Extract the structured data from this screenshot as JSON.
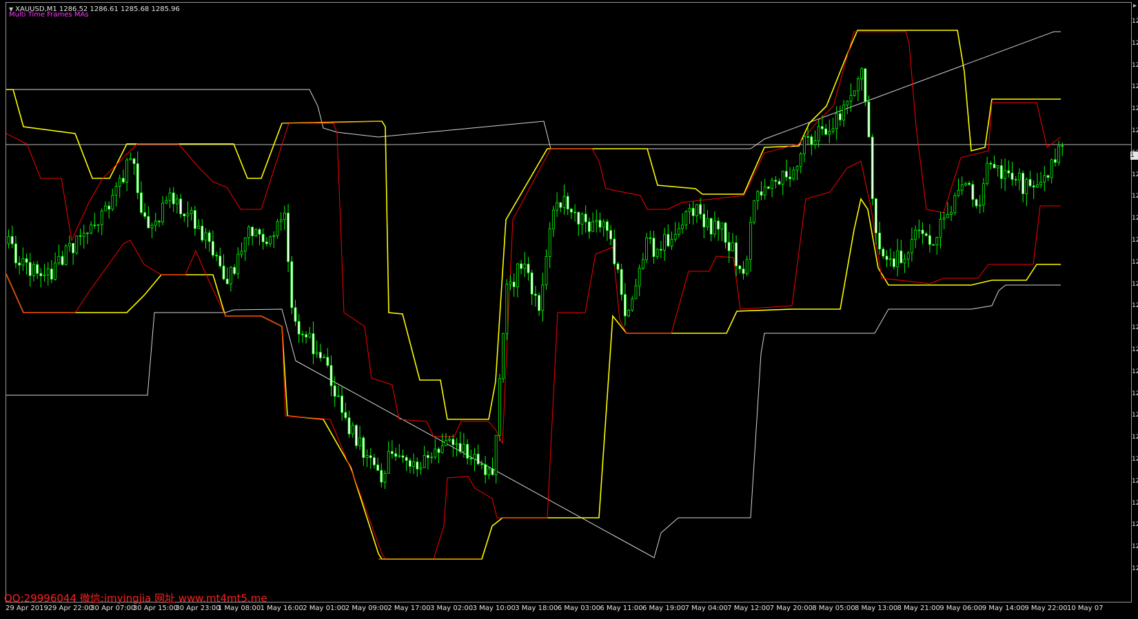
{
  "header": {
    "symbol_line": "XAUUSD,M1  1286.52 1286.61 1285.68 1285.96",
    "indicator_label": "Multi Time Frames MAs"
  },
  "watermark": "QQ:29996044 微信:imyingjia 网址 www.mt4mt5.me",
  "current_price": "1",
  "price_axis_labels": [
    "12",
    "12",
    "12",
    "12",
    "12",
    "12",
    "12",
    "12",
    "12",
    "12",
    "12",
    "12",
    "12",
    "12",
    "12",
    "12",
    "12",
    "12",
    "12",
    "12",
    "12",
    "12",
    "12",
    "12",
    "12",
    "12"
  ],
  "time_axis_labels": [
    "29 Apr 2019",
    "29 Apr 22:00",
    "30 Apr 07:00",
    "30 Apr 15:00",
    "30 Apr 23:00",
    "1 May 08:00",
    "1 May 16:00",
    "2 May 01:00",
    "2 May 09:00",
    "2 May 17:00",
    "3 May 02:00",
    "3 May 10:00",
    "3 May 18:00",
    "6 May 03:00",
    "6 May 11:00",
    "6 May 19:00",
    "7 May 04:00",
    "7 May 12:00",
    "7 May 20:00",
    "8 May 05:00",
    "8 May 13:00",
    "8 May 21:00",
    "9 May 06:00",
    "9 May 14:00",
    "9 May 22:00",
    "10 May 07"
  ],
  "colors": {
    "background": "#000000",
    "bull_candle": "#00ff00",
    "bear_candle_body": "#ffffff",
    "ma_white": "#d8d8d8",
    "ma_yellow": "#ffff00",
    "ma_red": "#ff0000",
    "ma_orange": "#ff8c00",
    "watermark": "#ff2020",
    "indicator_label": "#ff38ff"
  },
  "icons": {
    "symbol_triangle": "triangle-down-icon",
    "corner": "scroll-arrow-icon"
  },
  "chart_data": {
    "type": "line",
    "series": [
      {
        "values": [
          1289.0,
          1289.0,
          1289.0,
          1289.0,
          1289.0,
          1289.0,
          1289.0,
          1289.0,
          1289.0,
          1289.0,
          1289.0,
          1289.0,
          1289.0,
          1289.0,
          1289.0,
          1288.2,
          1288.0,
          1288.0,
          1288.0,
          1288.0,
          1287.9,
          1287.9,
          1287.9,
          1287.9,
          1287.9,
          1287.9,
          1287.9,
          1287.9,
          1287.9,
          1287.9,
          1287.9,
          1287.9,
          1287.9,
          1287.9,
          1287.9,
          1287.9,
          1287.9,
          1287.9,
          1287.6,
          1287.6,
          1287.6,
          1287.6,
          1287.6,
          1287.6,
          1287.6,
          1287.6,
          1287.6,
          1287.6,
          1287.6,
          1287.6,
          1287.6,
          1287.6,
          1287.6,
          1287.6,
          1287.6,
          1287.6,
          1287.6,
          1287.6,
          1287.6,
          1287.6,
          1287.6,
          1287.6,
          1287.6,
          1287.6,
          1287.6,
          1287.6,
          1287.6,
          1287.6,
          1287.6,
          1287.6,
          1287.6,
          1287.6,
          1287.6,
          1287.6,
          1287.6,
          1287.6,
          1287.6,
          1287.6,
          1291.2,
          1291.2,
          1291.2,
          1291.2,
          1291.2,
          1291.2,
          1291.2,
          1291.2,
          1291.2,
          1291.2,
          1291.2,
          1291.2,
          1291.2,
          1291.2,
          1291.2,
          1291.2,
          1291.2,
          1291.2,
          1291.2,
          1291.2,
          1291.2,
          1291.2,
          1291.2,
          1291.2,
          1291.2,
          1291.2,
          1291.2,
          1291.2,
          1291.2,
          1291.2,
          1291.2,
          1291.2,
          1291.2,
          1291.2,
          1291.2,
          1291.2,
          1291.2,
          1291.2,
          1291.2,
          1291.2,
          1291.2,
          1291.2,
          1291.2,
          1291.2,
          1291.2,
          1291.2,
          1291.2,
          1291.2,
          1291.2,
          1291.2,
          1291.2,
          1291.2,
          1291.2,
          1291.2,
          1291.2,
          1291.2,
          1291.2,
          1291.2,
          1291.2,
          1291.2,
          1291.2,
          1291.2,
          1291.2,
          1291.2,
          1291.2,
          1291.2,
          1291.2,
          1291.2,
          1291.2,
          1291.2,
          1291.2,
          1291.2,
          1291.2,
          1291.2,
          1291.2,
          1291.2,
          1291.2,
          1291.2,
          1291.2,
          1291.2,
          1291.2,
          1291.2,
          1291.2,
          1291.2,
          1291.2,
          1291.2,
          1291.2,
          1291.2,
          1291.2,
          1291.2,
          1291.2,
          1291.2,
          1291.2,
          1291.2,
          1291.2,
          1291.2,
          1291.2,
          1291.2,
          1291.2,
          1291.2,
          1291.2,
          1291.2,
          1291.2,
          1291.2,
          1291.2,
          1291.2,
          1291.2,
          1291.2,
          1291.2,
          1291.2,
          1291.2,
          1291.2,
          1291.2,
          1291.2,
          1291.2,
          1291.2,
          1291.2,
          1291.2,
          1291.2,
          1291.2,
          1291.2,
          1291.2,
          1291.2,
          1291.2,
          1291.2,
          1291.2,
          1291.2,
          1291.2,
          1291.2,
          1291.2,
          1291.2,
          1291.2,
          1291.2,
          1291.2,
          1291.2,
          1291.2,
          1291.2,
          1291.2,
          1291.2,
          1291.2,
          1291.2,
          1291.2,
          1291.2,
          1291.2,
          1291.2,
          1291.2,
          1291.2,
          1291.2,
          1291.2,
          1291.2,
          1291.2,
          1291.2,
          1291.2,
          1291.2,
          1291.2,
          1291.2,
          1291.2,
          1291.2,
          1291.2,
          1291.2,
          1291.2,
          1291.2,
          1291.2,
          1291.2,
          1291.2,
          1291.2,
          1291.2,
          1291.2,
          1291.2,
          1291.2,
          1291.2,
          1291.2,
          1291.2,
          1291.2,
          1291.2,
          1291.2,
          1291.2,
          1291.2,
          1291.2,
          1291.2,
          1291.2,
          1291.2,
          1291.2,
          1291.2,
          1291.2,
          1291.2,
          1291.2,
          1291.2,
          1291.2,
          1291.2,
          1291.2
        ]
      },
      {
        "values": [
          1284.7,
          1284.7,
          1284.7,
          1284.7,
          1284.7,
          1284.7,
          1284.7,
          1284.7,
          1284.7,
          1284.7,
          1284.7,
          1284.7,
          1284.7,
          1284.7,
          1284.7,
          1284.7,
          1284.7,
          1284.7,
          1284.7,
          1284.7,
          1284.7,
          1284.7,
          1284.7,
          1284.7,
          1284.7,
          1284.7,
          1284.7,
          1284.7,
          1284.7,
          1284.7,
          1284.7,
          1284.7,
          1284.7,
          1284.7,
          1284.7,
          1284.7,
          1284.7,
          1284.7,
          1284.7,
          1284.7,
          1284.7,
          1284.7,
          1284.7,
          1284.7,
          1284.7,
          1284.7,
          1284.7,
          1284.7,
          1284.7,
          1284.7,
          1284.7,
          1284.7,
          1284.7,
          1284.7,
          1284.7,
          1284.7,
          1284.7,
          1284.7,
          1284.7,
          1284.7,
          1284.7,
          1284.7,
          1284.7,
          1284.7,
          1284.7,
          1284.7,
          1284.7,
          1284.7,
          1284.7,
          1284.7,
          1284.7,
          1284.7,
          1284.7,
          1284.7,
          1284.7,
          1284.7,
          1284.7,
          1284.7,
          1284.7,
          1284.7,
          1284.7,
          1284.7,
          1284.7,
          1284.7,
          1284.7,
          1284.7,
          1284.7,
          1284.7,
          1284.7,
          1284.7,
          1284.7,
          1284.7,
          1284.7,
          1284.7,
          1284.7,
          1284.7,
          1284.7,
          1284.7,
          1284.7,
          1284.7,
          1284.7,
          1284.7,
          1284.7,
          1284.7,
          1284.7,
          1284.7,
          1284.7,
          1284.7,
          1284.7,
          1284.7,
          1284.7,
          1284.7,
          1284.7,
          1284.7,
          1284.7,
          1284.7,
          1284.7,
          1284.7,
          1284.7,
          1284.7,
          1284.7,
          1284.7,
          1284.7,
          1284.7,
          1284.7,
          1284.7,
          1284.7,
          1284.7,
          1284.7,
          1284.7,
          1284.7,
          1284.7,
          1284.7,
          1284.7,
          1284.7,
          1284.7,
          1284.7,
          1284.7,
          1284.7,
          1284.7,
          1284.7,
          1284.7,
          1284.7,
          1284.7,
          1284.7,
          1284.7,
          1284.7,
          1284.7,
          1284.7,
          1284.7,
          1284.7,
          1284.7,
          1284.7,
          1284.7,
          1284.7,
          1284.7,
          1284.7,
          1284.7,
          1284.7,
          1284.7,
          1284.7,
          1284.7,
          1284.7,
          1284.7,
          1284.7,
          1284.7,
          1284.7,
          1284.7,
          1284.7,
          1284.7,
          1284.7,
          1284.7,
          1284.7,
          1284.7,
          1284.7,
          1284.7,
          1284.7,
          1284.7,
          1284.7,
          1284.7,
          1284.7,
          1284.7,
          1284.7,
          1284.7,
          1284.7,
          1284.7,
          1284.7,
          1284.7,
          1284.7,
          1284.7,
          1284.7,
          1284.7,
          1284.7,
          1284.7,
          1284.7,
          1284.7,
          1284.7,
          1284.7,
          1284.7,
          1284.7,
          1284.7,
          1284.7,
          1284.7,
          1284.7,
          1284.7,
          1284.7,
          1284.7,
          1284.7,
          1284.7,
          1284.7,
          1284.7,
          1284.7,
          1284.7,
          1284.7,
          1284.7,
          1284.7,
          1284.7,
          1284.7,
          1284.7,
          1284.7,
          1284.7,
          1284.7,
          1284.7,
          1284.7,
          1284.7,
          1284.7,
          1284.7,
          1284.7,
          1284.7,
          1284.7,
          1284.7,
          1284.7,
          1284.7,
          1284.7,
          1284.7,
          1284.7,
          1284.7,
          1284.7,
          1284.7,
          1284.7,
          1284.7,
          1284.7,
          1284.7,
          1284.7,
          1284.7,
          1284.7,
          1284.7,
          1284.7,
          1284.7,
          1284.7,
          1284.7,
          1284.7,
          1284.7,
          1284.7,
          1284.7,
          1284.7,
          1284.7,
          1284.7,
          1284.7,
          1284.7,
          1284.7,
          1284.7,
          1284.7,
          1284.7
        ]
      }
    ],
    "grid": false
  }
}
